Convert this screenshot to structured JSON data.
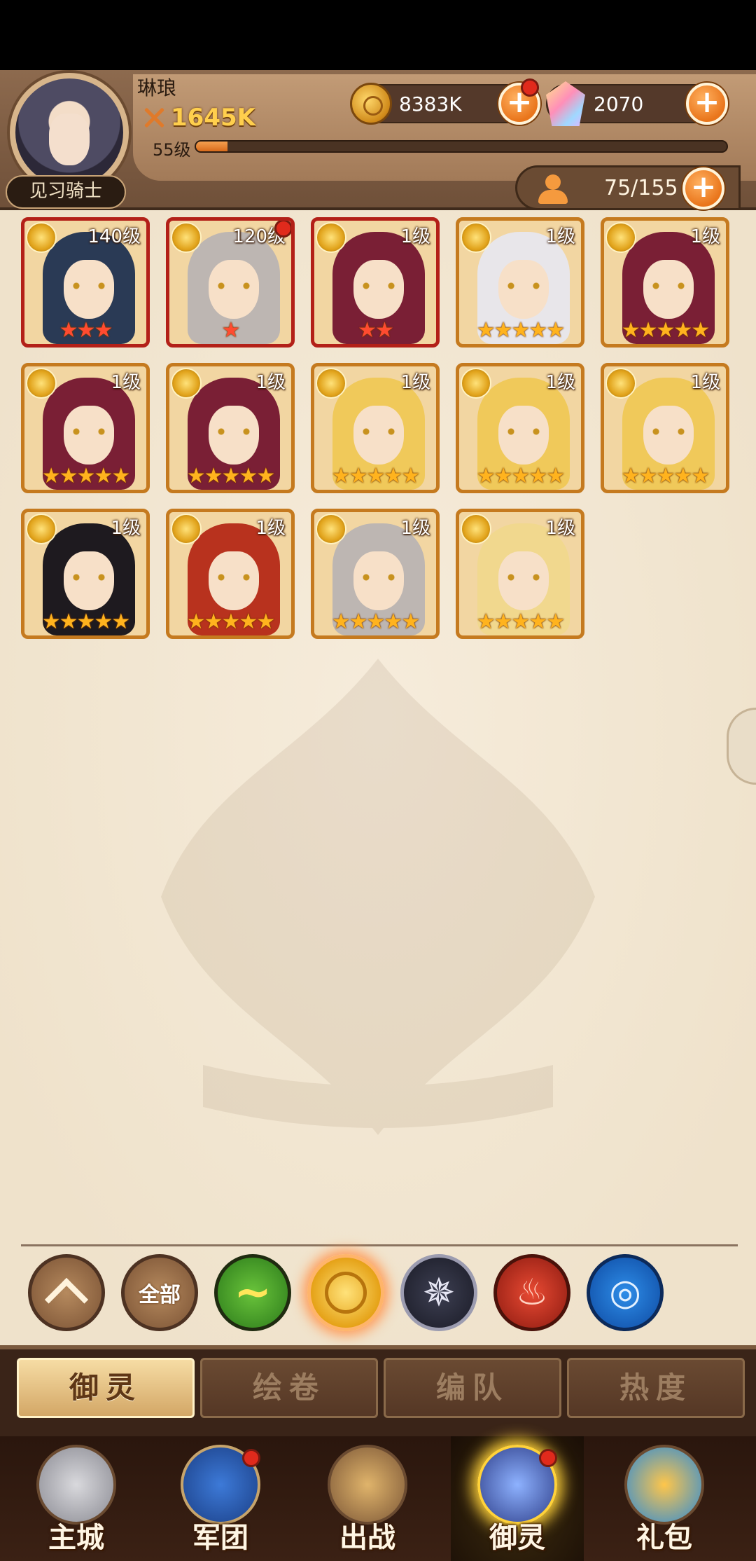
{
  "player": {
    "name": "琳琅",
    "power": "1645K",
    "level": "55级",
    "xp_progress": 0.06,
    "title": "见习骑士"
  },
  "resources": {
    "gold": "8383K",
    "gems": "2070",
    "roster": "75/155"
  },
  "heroes": [
    {
      "level": "140级",
      "stars": 3,
      "frame": "red",
      "hair": "#2a3a55",
      "dot": false
    },
    {
      "level": "120级",
      "stars": 1,
      "frame": "red",
      "hair": "#bdb6b2",
      "dot": true
    },
    {
      "level": "1级",
      "stars": 2,
      "frame": "red",
      "hair": "#7a1f35",
      "dot": false
    },
    {
      "level": "1级",
      "stars": 5,
      "frame": "gold",
      "hair": "#e8e6ea",
      "dot": false
    },
    {
      "level": "1级",
      "stars": 5,
      "frame": "gold",
      "hair": "#7a1f35",
      "dot": false
    },
    {
      "level": "1级",
      "stars": 5,
      "frame": "gold",
      "hair": "#7a1f35",
      "dot": false
    },
    {
      "level": "1级",
      "stars": 5,
      "frame": "gold",
      "hair": "#7a1f35",
      "dot": false
    },
    {
      "level": "1级",
      "stars": 5,
      "frame": "gold",
      "hair": "#f0c95a",
      "dot": false
    },
    {
      "level": "1级",
      "stars": 5,
      "frame": "gold",
      "hair": "#f0c95a",
      "dot": false
    },
    {
      "level": "1级",
      "stars": 5,
      "frame": "gold",
      "hair": "#f0c95a",
      "dot": false
    },
    {
      "level": "1级",
      "stars": 5,
      "frame": "gold",
      "hair": "#1e1a1f",
      "dot": false
    },
    {
      "level": "1级",
      "stars": 5,
      "frame": "gold",
      "hair": "#b8321e",
      "dot": false
    },
    {
      "level": "1级",
      "stars": 5,
      "frame": "gold",
      "hair": "#bdb6b2",
      "dot": false
    },
    {
      "level": "1级",
      "stars": 5,
      "frame": "gold",
      "hair": "#f1d88e",
      "dot": false
    }
  ],
  "filters": {
    "all_label": "全部",
    "items": [
      "collapse-icon",
      "all",
      "wind-element-icon",
      "light-element-icon",
      "dark-element-icon",
      "fire-element-icon",
      "water-element-icon"
    ]
  },
  "subtabs": [
    {
      "label": "御灵",
      "active": true
    },
    {
      "label": "绘卷",
      "active": false
    },
    {
      "label": "编队",
      "active": false
    },
    {
      "label": "热度",
      "active": false
    }
  ],
  "nav": [
    {
      "label": "主城",
      "icon": "castle-icon",
      "active": false,
      "dot": false
    },
    {
      "label": "军团",
      "icon": "fist-shield-icon",
      "active": false,
      "dot": true
    },
    {
      "label": "出战",
      "icon": "sword-gate-icon",
      "active": false,
      "dot": false
    },
    {
      "label": "御灵",
      "icon": "crystal-icon",
      "active": true,
      "dot": true
    },
    {
      "label": "礼包",
      "icon": "gift-shop-icon",
      "active": false,
      "dot": false
    }
  ],
  "colors": {
    "accent": "#e9751b",
    "star_gold": "#ffb31e",
    "star_red": "#ff4b30",
    "frame_gold": "#c57a1f",
    "frame_red": "#b32018"
  }
}
